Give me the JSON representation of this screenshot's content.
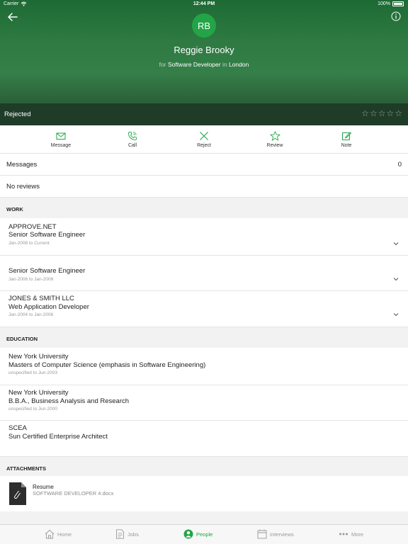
{
  "status_bar": {
    "carrier": "Carrier",
    "time": "12:44 PM",
    "battery": "100%"
  },
  "header": {
    "initials": "RB",
    "name": "Reggie Brooky",
    "subtitle_for": "for",
    "role": "Software Developer",
    "subtitle_in": "in",
    "location": "London"
  },
  "status": {
    "label": "Rejected",
    "rating": 0,
    "rating_max": 5
  },
  "actions": [
    {
      "label": "Message",
      "icon": "envelope-icon"
    },
    {
      "label": "Call",
      "icon": "phone-icon"
    },
    {
      "label": "Reject",
      "icon": "x-icon"
    },
    {
      "label": "Review",
      "icon": "star-icon"
    },
    {
      "label": "Note",
      "icon": "note-icon"
    }
  ],
  "messages": {
    "label": "Messages",
    "count": "0"
  },
  "reviews": {
    "label": "No reviews"
  },
  "work": {
    "title": "WORK",
    "items": [
      {
        "company": "APPROVE.NET",
        "position": "Senior Software Engineer",
        "dates": "Jan-2008 to Current"
      },
      {
        "company": "",
        "position": "Senior Software Engineer",
        "dates": "Jan-2006 to Jan-2008"
      },
      {
        "company": "JONES & SMITH LLC",
        "position": "Web Application Developer",
        "dates": "Jan-2004 to Jan-2006"
      }
    ]
  },
  "education": {
    "title": "EDUCATION",
    "items": [
      {
        "school": "New York University",
        "degree": "Masters of Computer Science (emphasis in Software Engineering)",
        "dates": "unspecified to Jun-2003"
      },
      {
        "school": "New York University",
        "degree": "B.B.A., Business Analysis and Research",
        "dates": "unspecified to Jun-2000"
      },
      {
        "school": "SCEA",
        "degree": "Sun Certified Enterprise Architect",
        "dates": ""
      }
    ]
  },
  "attachments": {
    "title": "ATTACHMENTS",
    "items": [
      {
        "label": "Resume",
        "file": "SOFTWARE DEVELOPER 4.docx"
      }
    ]
  },
  "tabs": [
    {
      "label": "Home",
      "icon": "home-icon",
      "active": false
    },
    {
      "label": "Jobs",
      "icon": "jobs-icon",
      "active": false
    },
    {
      "label": "People",
      "icon": "people-icon",
      "active": true
    },
    {
      "label": "Interviews",
      "icon": "calendar-icon",
      "active": false
    },
    {
      "label": "More",
      "icon": "more-icon",
      "active": false
    }
  ],
  "colors": {
    "accent": "#22a447",
    "header_dark": "#1f3c28"
  }
}
